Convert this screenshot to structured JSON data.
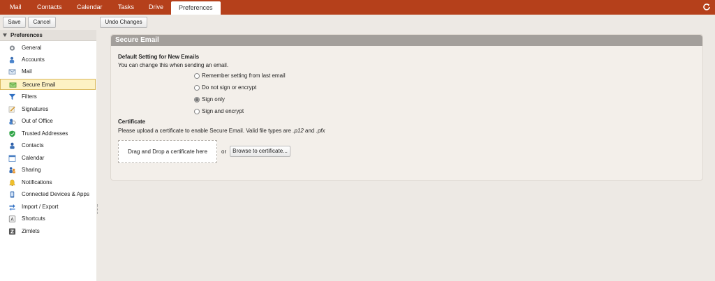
{
  "nav": {
    "tabs": [
      "Mail",
      "Contacts",
      "Calendar",
      "Tasks",
      "Drive",
      "Preferences"
    ],
    "active": "Preferences",
    "refresh_icon": "refresh-icon"
  },
  "toolbar": {
    "save_label": "Save",
    "cancel_label": "Cancel",
    "undo_label": "Undo Changes"
  },
  "sidebar": {
    "header": "Preferences",
    "items": [
      {
        "label": "General",
        "icon": "gear-icon"
      },
      {
        "label": "Accounts",
        "icon": "accounts-icon"
      },
      {
        "label": "Mail",
        "icon": "mail-icon"
      },
      {
        "label": "Secure Email",
        "icon": "secure-email-icon"
      },
      {
        "label": "Filters",
        "icon": "filters-icon"
      },
      {
        "label": "Signatures",
        "icon": "signature-icon"
      },
      {
        "label": "Out of Office",
        "icon": "out-of-office-icon"
      },
      {
        "label": "Trusted Addresses",
        "icon": "shield-check-icon"
      },
      {
        "label": "Contacts",
        "icon": "contacts-icon"
      },
      {
        "label": "Calendar",
        "icon": "calendar-icon"
      },
      {
        "label": "Sharing",
        "icon": "sharing-icon"
      },
      {
        "label": "Notifications",
        "icon": "bell-icon"
      },
      {
        "label": "Connected Devices & Apps",
        "icon": "device-icon"
      },
      {
        "label": "Import / Export",
        "icon": "import-export-icon"
      },
      {
        "label": "Shortcuts",
        "icon": "shortcuts-icon"
      },
      {
        "label": "Zimlets",
        "icon": "zimlets-icon"
      }
    ],
    "selected": "Secure Email"
  },
  "content": {
    "title": "Secure Email",
    "default_setting_heading": "Default Setting for New Emails",
    "default_setting_note": "You can change this when sending an email.",
    "options": [
      {
        "label": "Remember setting from last email",
        "selected": false
      },
      {
        "label": "Do not sign or encrypt",
        "selected": false
      },
      {
        "label": "Sign only",
        "selected": true
      },
      {
        "label": "Sign and encrypt",
        "selected": false
      }
    ],
    "certificate_heading": "Certificate",
    "certificate_note_prefix": "Please upload a certificate to enable Secure Email. Valid file types are ",
    "certificate_type_1": ".p12",
    "certificate_and": " and ",
    "certificate_type_2": ".pfx",
    "dropzone_label": "Drag and Drop a certificate here",
    "or_label": "or",
    "browse_label": "Browse to certificate..."
  },
  "colors": {
    "topbar": "#b5401b",
    "selection_bg": "#fdf2c4",
    "panel_title": "#a39f9b"
  }
}
